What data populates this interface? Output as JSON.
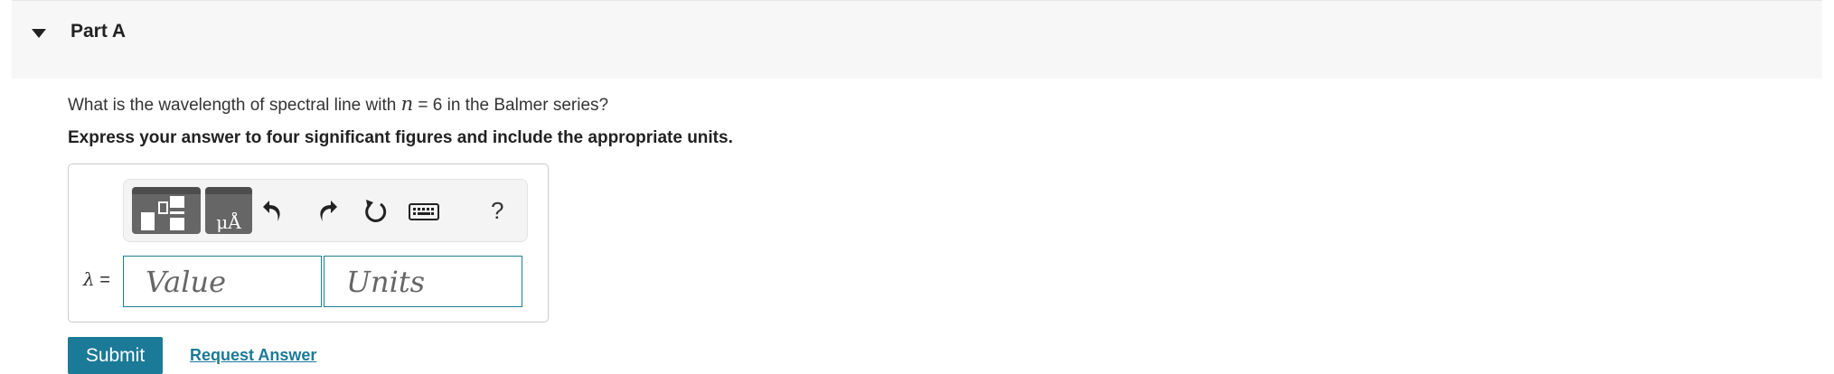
{
  "part": {
    "title": "Part A"
  },
  "question": {
    "text_before": "What is the wavelength of spectral line with ",
    "variable": "n",
    "text_after": " = 6 in the Balmer series?"
  },
  "instruction": "Express your answer to four significant figures and include the appropriate units.",
  "toolbar": {
    "units_glyph": "μÅ",
    "help_label": "?"
  },
  "answer": {
    "symbol": "λ",
    "equals": " =",
    "value_placeholder": "Value",
    "units_placeholder": "Units"
  },
  "actions": {
    "submit_label": "Submit",
    "request_label": "Request Answer"
  },
  "colors": {
    "accent": "#1b7a97",
    "header_bg": "#f7f7f7",
    "toolbar_button": "#666666"
  }
}
